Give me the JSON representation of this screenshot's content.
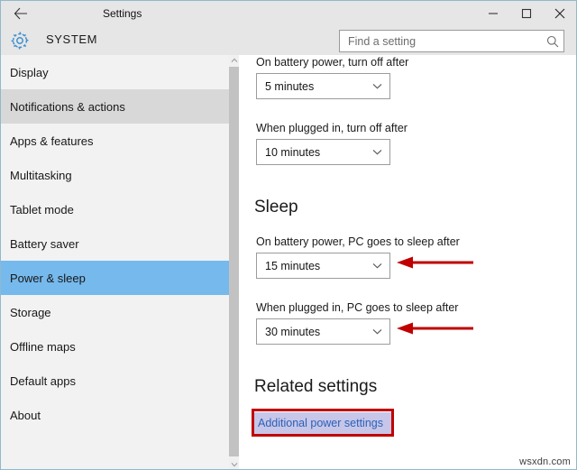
{
  "window": {
    "titlebar_title": "Settings",
    "back_icon": "back-arrow-icon",
    "minimize_label": "─",
    "maximize_label": "□",
    "close_label": "✕"
  },
  "header": {
    "icon": "gear-icon",
    "title": "SYSTEM",
    "search": {
      "placeholder": "Find a setting",
      "value": "",
      "icon": "search-icon"
    }
  },
  "sidebar": {
    "items": [
      {
        "label": "Display",
        "state": "normal"
      },
      {
        "label": "Notifications & actions",
        "state": "hovered"
      },
      {
        "label": "Apps & features",
        "state": "normal"
      },
      {
        "label": "Multitasking",
        "state": "normal"
      },
      {
        "label": "Tablet mode",
        "state": "normal"
      },
      {
        "label": "Battery saver",
        "state": "normal"
      },
      {
        "label": "Power & sleep",
        "state": "selected"
      },
      {
        "label": "Storage",
        "state": "normal"
      },
      {
        "label": "Offline maps",
        "state": "normal"
      },
      {
        "label": "Default apps",
        "state": "normal"
      },
      {
        "label": "About",
        "state": "normal"
      }
    ],
    "scrollbar": {
      "up_arrow": "chevron-up-icon",
      "down_arrow": "chevron-down-icon"
    }
  },
  "main": {
    "screen_fields": [
      {
        "label": "On battery power, turn off after",
        "value": "5 minutes"
      },
      {
        "label": "When plugged in, turn off after",
        "value": "10 minutes"
      }
    ],
    "sleep_heading": "Sleep",
    "sleep_fields": [
      {
        "label": "On battery power, PC goes to sleep after",
        "value": "15 minutes"
      },
      {
        "label": "When plugged in, PC goes to sleep after",
        "value": "30 minutes"
      }
    ],
    "related_heading": "Related settings",
    "related_link": "Additional power settings"
  },
  "annotations": {
    "arrow_color": "#c00000",
    "box_color": "#c00000",
    "link_highlight_color": "#c7c6e8",
    "arrow_count": 2
  },
  "watermark": "wsxdn.com",
  "colors": {
    "accent_selected": "#76b9ec",
    "hover": "#d8d8d8",
    "sidebar_bg": "#f2f2f2",
    "chrome_bg": "#e6e6e6",
    "link": "#2a61b8",
    "gear_blue": "#3f8fd0"
  }
}
